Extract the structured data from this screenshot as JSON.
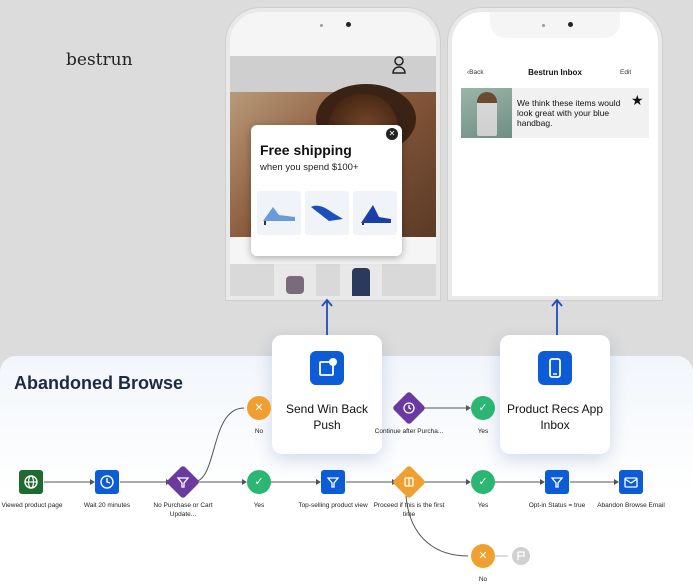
{
  "left_phone": {
    "brand": "bestrun",
    "popup": {
      "title": "Free shipping",
      "subtitle": "when you spend $100+"
    }
  },
  "right_phone": {
    "back": "‹Back",
    "title": "Bestrun Inbox",
    "edit": "Edit",
    "message": "We think these items would look great with your blue handbag."
  },
  "cards": {
    "push": "Send Win Back Push",
    "inbox": "Product Recs App Inbox"
  },
  "journey": {
    "title": "Abandoned Browse",
    "nodes": {
      "viewed": "Viewed product page",
      "wait": "Wait 20 minutes",
      "no_purchase": "No Purchase or Cart Update...",
      "yes1": "Yes",
      "top_selling": "Top-selling product view",
      "proceed": "Proceed if this is the first time",
      "yes2": "Yes",
      "optin": "Opt-in Status = true",
      "abandon_email": "Abandon Browse Email",
      "no_top": "No",
      "continue_after": "Continue after Purcha...",
      "yes_top": "Yes",
      "no_bottom": "No"
    }
  },
  "colors": {
    "blue": "#0b5cd6",
    "green_start": "#1e6b30",
    "purple": "#6a3aa0",
    "orange": "#f0a030",
    "green_check": "#2bb673",
    "gray": "#c8c8c8"
  }
}
